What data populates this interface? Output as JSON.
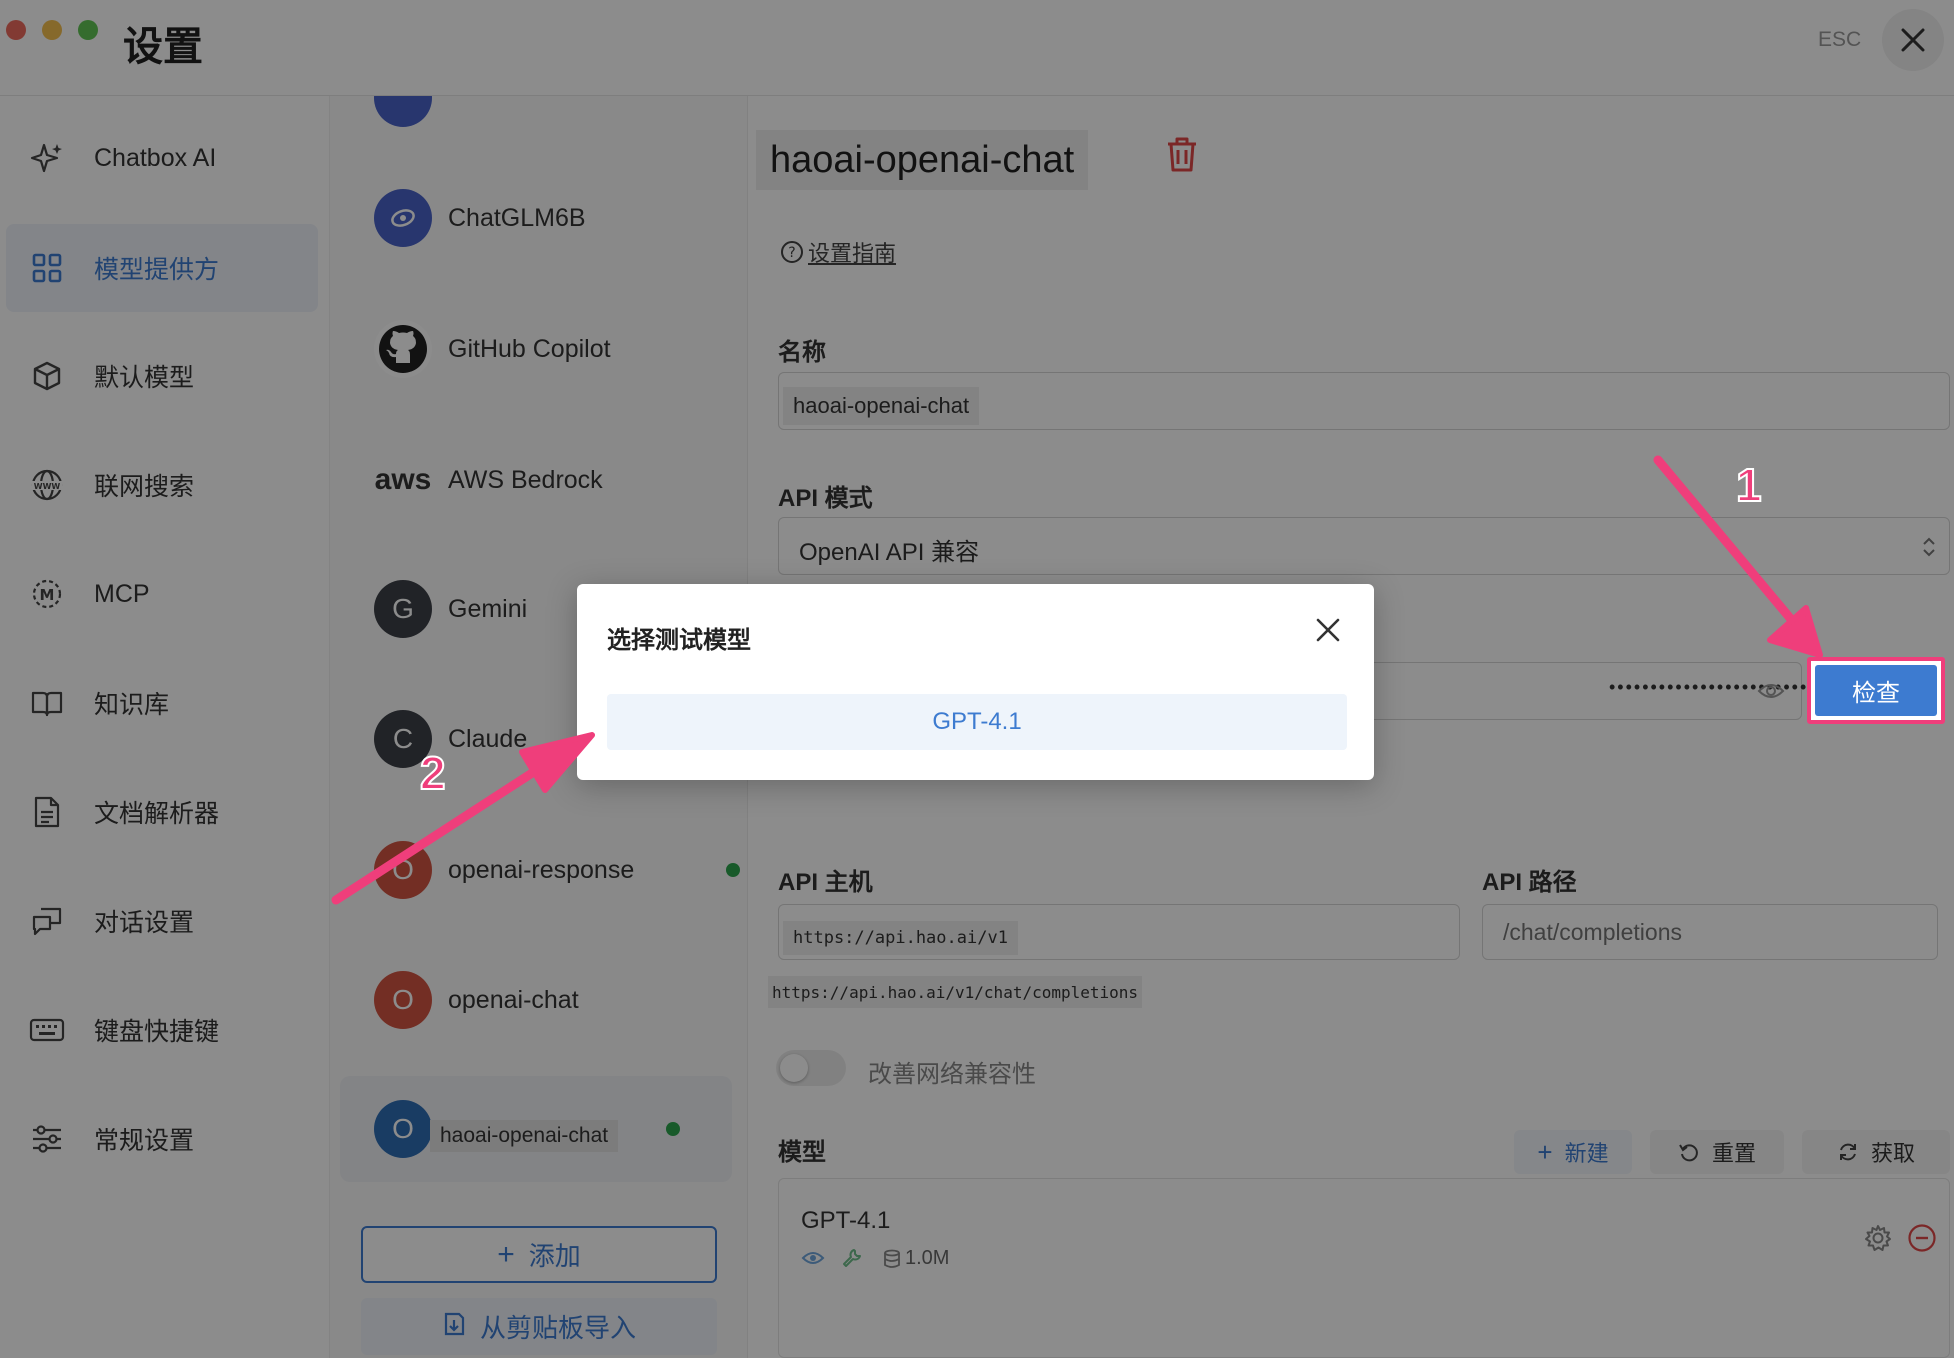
{
  "window": {
    "title": "设置",
    "esc_label": "ESC",
    "traffic_colors": [
      "#ed6a5e",
      "#f5bf4f",
      "#61c554"
    ]
  },
  "sidebar": {
    "items": [
      {
        "label": "Chatbox AI",
        "icon": "sparkle-icon",
        "active": false
      },
      {
        "label": "模型提供方",
        "icon": "grid-icon",
        "active": true
      },
      {
        "label": "默认模型",
        "icon": "cube-icon",
        "active": false
      },
      {
        "label": "联网搜索",
        "icon": "globe-www-icon",
        "active": false
      },
      {
        "label": "MCP",
        "icon": "mcp-icon",
        "active": false
      },
      {
        "label": "知识库",
        "icon": "book-icon",
        "active": false
      },
      {
        "label": "文档解析器",
        "icon": "document-icon",
        "active": false
      },
      {
        "label": "对话设置",
        "icon": "chat-settings-icon",
        "active": false
      },
      {
        "label": "键盘快捷键",
        "icon": "keyboard-icon",
        "active": false
      },
      {
        "label": "常规设置",
        "icon": "sliders-icon",
        "active": false
      }
    ]
  },
  "providers": {
    "items": [
      {
        "name": "ChatGLM6B",
        "avatar": "",
        "color": "#4a63c8",
        "connected": false
      },
      {
        "name": "GitHub Copilot",
        "avatar": "",
        "color": "#222222",
        "connected": false
      },
      {
        "name": "AWS Bedrock",
        "avatar": "aws",
        "color": "#333333",
        "connected": false
      },
      {
        "name": "Gemini",
        "avatar": "G",
        "color": "#3d4148",
        "connected": false
      },
      {
        "name": "Claude",
        "avatar": "C",
        "color": "#3d4148",
        "connected": false
      },
      {
        "name": "openai-response",
        "avatar": "O",
        "color": "#d25542",
        "connected": true
      },
      {
        "name": "openai-chat",
        "avatar": "O",
        "color": "#d25542",
        "connected": false
      },
      {
        "name": "haoai-openai-chat",
        "avatar": "O",
        "color": "#2f6db5",
        "connected": true
      }
    ],
    "add_label": "添加",
    "import_label": "从剪贴板导入"
  },
  "main": {
    "provider_title": "haoai-openai-chat",
    "guide_label": "设置指南",
    "name_label": "名称",
    "name_value": "haoai-openai-chat",
    "api_mode_label": "API 模式",
    "api_mode_value": "OpenAI API 兼容",
    "api_key_mask": "••••••••••••••••••••••••",
    "check_label": "检查",
    "api_host_label": "API 主机",
    "api_host_value": "https://api.hao.ai/v1",
    "api_path_label": "API 路径",
    "api_path_placeholder": "/chat/completions",
    "full_url": "https://api.hao.ai/v1/chat/completions",
    "compat_label": "改善网络兼容性",
    "models_label": "模型",
    "new_label": "新建",
    "reset_label": "重置",
    "fetch_label": "获取",
    "models": [
      {
        "name": "GPT-4.1",
        "context": "1.0M"
      }
    ]
  },
  "dialog": {
    "title": "选择测试模型",
    "option": "GPT-4.1"
  },
  "annotations": {
    "step1": "1",
    "step2": "2",
    "color": "#ef3e7b"
  }
}
